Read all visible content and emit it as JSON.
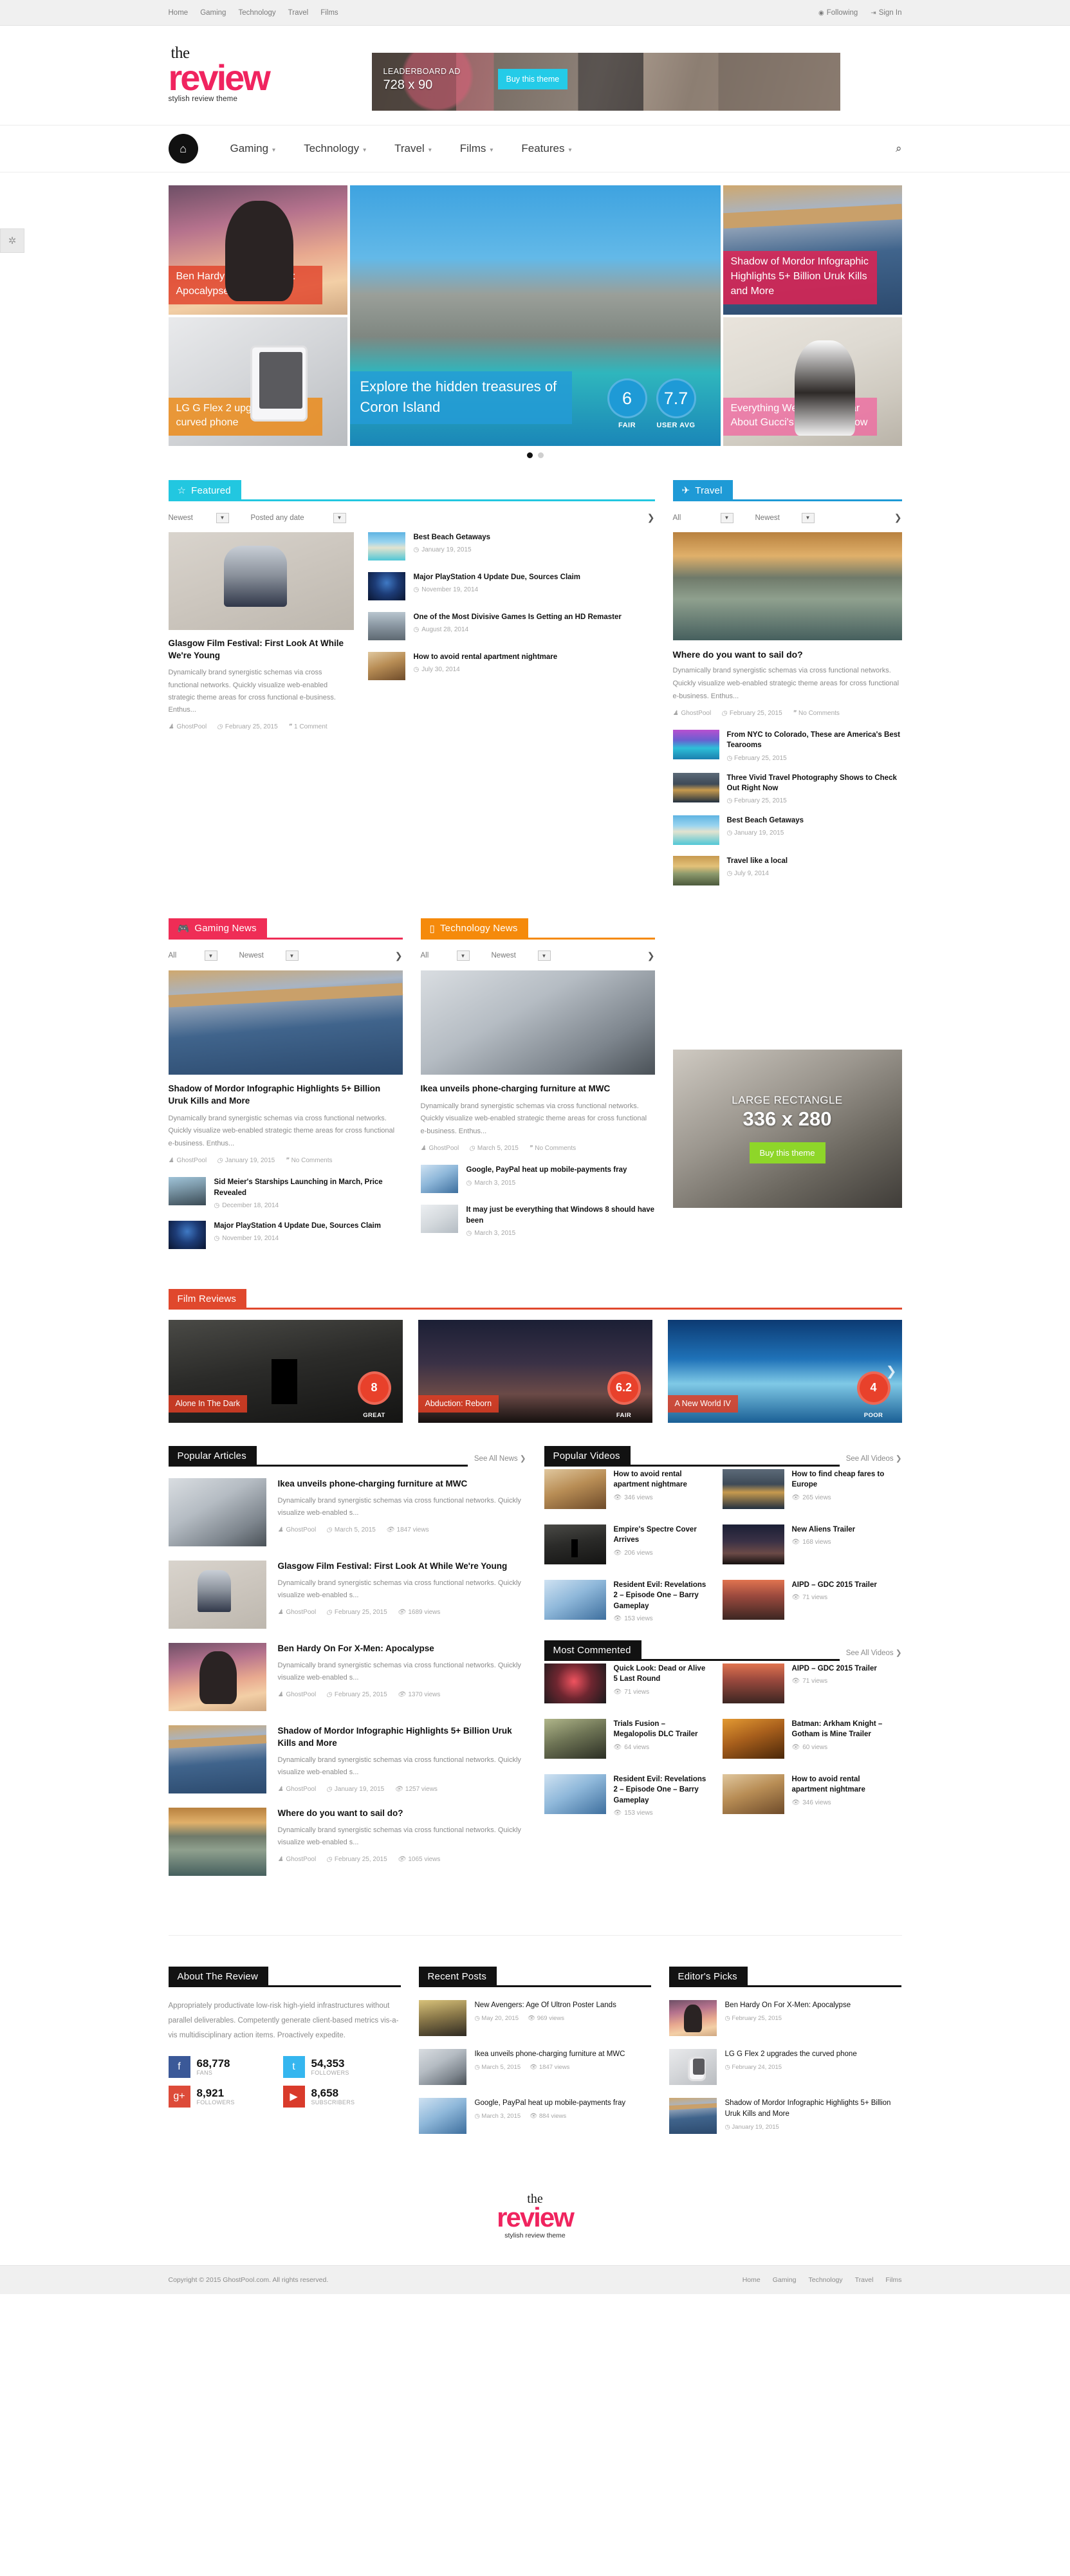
{
  "topbar": {
    "nav": [
      "Home",
      "Gaming",
      "Technology",
      "Travel",
      "Films"
    ],
    "following": "Following",
    "signin": "Sign In"
  },
  "logo": {
    "the": "the",
    "review": "review",
    "tagline": "stylish review theme"
  },
  "leaderboard_ad": {
    "line1": "LEADERBOARD AD",
    "line2": "728 x 90",
    "button": "Buy this theme"
  },
  "mainnav": {
    "items": [
      "Gaming",
      "Technology",
      "Travel",
      "Films",
      "Features"
    ]
  },
  "hero": {
    "left": [
      {
        "title": "Ben Hardy On For X-Men: Apocalypse",
        "cap_class": "red",
        "img": "im-hood"
      },
      {
        "title": "LG G Flex 2 upgrades the curved phone",
        "cap_class": "orange",
        "img": "im-phone"
      }
    ],
    "main": {
      "title": "Explore the hidden treasures of Coron Island",
      "cap_class": "blue",
      "img": "im-island",
      "scores": [
        {
          "value": "6",
          "label": "FAIR"
        },
        {
          "value": "7.7",
          "label": "USER AVG"
        }
      ]
    },
    "right": [
      {
        "title": "Shadow of Mordor Infographic Highlights 5+ Billion Uruk Kills and More",
        "cap_class": "crimson",
        "img": "im-bridge"
      },
      {
        "title": "Everything We Know So Far About Gucci's Fall 2015 Show",
        "cap_class": "pink",
        "img": "im-couple"
      }
    ]
  },
  "featured": {
    "tab": "Featured",
    "icon": "star-icon",
    "filters": [
      {
        "label": "Newest"
      },
      {
        "label": "Posted any date"
      }
    ],
    "main": {
      "img": "im-dj",
      "title": "Glasgow Film Festival: First Look At While We're Young",
      "excerpt": "Dynamically brand synergistic schemas via cross functional networks. Quickly visualize web-enabled strategic theme areas for cross functional e-business. Enthus...",
      "author": "GhostPool",
      "date": "February 25, 2015",
      "comments": "1 Comment"
    },
    "list": [
      {
        "title": "Best Beach Getaways",
        "date": "January 19, 2015",
        "img": "im-beach"
      },
      {
        "title": "Major PlayStation 4 Update Due, Sources Claim",
        "date": "November 19, 2014",
        "img": "im-ps"
      },
      {
        "title": "One of the Most Divisive Games Is Getting an HD Remaster",
        "date": "August 28, 2014",
        "img": "im-zombie"
      },
      {
        "title": "How to avoid rental apartment nightmare",
        "date": "July 30, 2014",
        "img": "im-room"
      }
    ]
  },
  "travel": {
    "tab": "Travel",
    "icon": "plane-icon",
    "filters": [
      {
        "label": "All"
      },
      {
        "label": "Newest"
      }
    ],
    "main": {
      "img": "im-pier",
      "title": "Where do you want to sail do?",
      "excerpt": "Dynamically brand synergistic schemas via cross functional networks. Quickly visualize web-enabled strategic theme areas for cross functional e-business. Enthus...",
      "author": "GhostPool",
      "date": "February 25, 2015",
      "comments": "No Comments"
    },
    "list": [
      {
        "title": "From NYC to Colorado, These are America's Best Tearooms",
        "date": "February 25, 2015",
        "img": "im-nyc"
      },
      {
        "title": "Three Vivid Travel Photography Shows to Check Out Right Now",
        "date": "February 25, 2015",
        "img": "im-lake"
      },
      {
        "title": "Best Beach Getaways",
        "date": "January 19, 2015",
        "img": "im-beach"
      },
      {
        "title": "Travel like a local",
        "date": "July 9, 2014",
        "img": "im-sunset"
      }
    ]
  },
  "gaming": {
    "tab": "Gaming News",
    "icon": "gamepad-icon",
    "filters": [
      {
        "label": "All"
      },
      {
        "label": "Newest"
      }
    ],
    "main": {
      "img": "im-bridge",
      "title": "Shadow of Mordor Infographic Highlights 5+ Billion Uruk Kills and More",
      "excerpt": "Dynamically brand synergistic schemas via cross functional networks. Quickly visualize web-enabled strategic theme areas for cross functional e-business. Enthus...",
      "author": "GhostPool",
      "date": "January 19, 2015",
      "comments": "No Comments"
    },
    "list": [
      {
        "title": "Sid Meier's Starships Launching in March, Price Revealed",
        "date": "December 18, 2014",
        "img": "im-starship"
      },
      {
        "title": "Major PlayStation 4 Update Due, Sources Claim",
        "date": "November 19, 2014",
        "img": "im-ps"
      }
    ]
  },
  "technology": {
    "tab": "Technology News",
    "icon": "mobile-icon",
    "filters": [
      {
        "label": "All"
      },
      {
        "label": "Newest"
      }
    ],
    "main": {
      "img": "im-tech",
      "title": "Ikea unveils phone-charging furniture at MWC",
      "excerpt": "Dynamically brand synergistic schemas via cross functional networks. Quickly visualize web-enabled strategic theme areas for cross functional e-business. Enthus...",
      "author": "GhostPool",
      "date": "March 5, 2015",
      "comments": "No Comments"
    },
    "list": [
      {
        "title": "Google, PayPal heat up mobile-payments fray",
        "date": "March 3, 2015",
        "img": "im-kbd"
      },
      {
        "title": "It may just be everything that Windows 8 should have been",
        "date": "March 3, 2015",
        "img": "im-win"
      }
    ]
  },
  "rect_ad": {
    "line1": "LARGE RECTANGLE",
    "line2": "336 x 280",
    "button": "Buy this theme"
  },
  "film_reviews": {
    "tab": "Film Reviews",
    "items": [
      {
        "name": "Alone In The Dark",
        "score": "8",
        "label": "GREAT",
        "img": "im-dark"
      },
      {
        "name": "Abduction: Reborn",
        "score": "6.2",
        "label": "FAIR",
        "img": "im-ufo"
      },
      {
        "name": "A New World IV",
        "score": "4",
        "label": "POOR",
        "img": "im-world"
      }
    ]
  },
  "popular_articles": {
    "tab": "Popular Articles",
    "seeall": "See All News",
    "items": [
      {
        "title": "Ikea unveils phone-charging furniture at MWC",
        "excerpt": "Dynamically brand synergistic schemas via cross functional networks. Quickly visualize web-enabled s...",
        "author": "GhostPool",
        "date": "March 5, 2015",
        "views": "1847 views",
        "img": "im-tech"
      },
      {
        "title": "Glasgow Film Festival: First Look At While We're Young",
        "excerpt": "Dynamically brand synergistic schemas via cross functional networks. Quickly visualize web-enabled s...",
        "author": "GhostPool",
        "date": "February 25, 2015",
        "views": "1689 views",
        "img": "im-dj"
      },
      {
        "title": "Ben Hardy On For X-Men: Apocalypse",
        "excerpt": "Dynamically brand synergistic schemas via cross functional networks. Quickly visualize web-enabled s...",
        "author": "GhostPool",
        "date": "February 25, 2015",
        "views": "1370 views",
        "img": "im-hood"
      },
      {
        "title": "Shadow of Mordor Infographic Highlights 5+ Billion Uruk Kills and More",
        "excerpt": "Dynamically brand synergistic schemas via cross functional networks. Quickly visualize web-enabled s...",
        "author": "GhostPool",
        "date": "January 19, 2015",
        "views": "1257 views",
        "img": "im-bridge"
      },
      {
        "title": "Where do you want to sail do?",
        "excerpt": "Dynamically brand synergistic schemas via cross functional networks. Quickly visualize web-enabled s...",
        "author": "GhostPool",
        "date": "February 25, 2015",
        "views": "1065 views",
        "img": "im-pier"
      }
    ]
  },
  "popular_videos": {
    "tab": "Popular Videos",
    "seeall": "See All Videos",
    "items": [
      {
        "title": "How to avoid rental apartment nightmare",
        "views": "346 views",
        "img": "im-room"
      },
      {
        "title": "How to find cheap fares to Europe",
        "views": "265 views",
        "img": "im-lake"
      },
      {
        "title": "Empire's Spectre Cover Arrives",
        "views": "206 views",
        "img": "im-dark"
      },
      {
        "title": "New Aliens Trailer",
        "views": "168 views",
        "img": "im-ufo"
      },
      {
        "title": "Resident Evil: Revelations 2 – Episode One – Barry Gameplay",
        "views": "153 views",
        "img": "im-kbd"
      },
      {
        "title": "AIPD – GDC 2015 Trailer",
        "views": "71 views",
        "img": "im-aipd"
      }
    ]
  },
  "most_commented": {
    "tab": "Most Commented",
    "seeall": "See All Videos",
    "items": [
      {
        "title": "Quick Look: Dead or Alive 5 Last Round",
        "views": "71 views",
        "img": "im-hand"
      },
      {
        "title": "AIPD – GDC 2015 Trailer",
        "views": "71 views",
        "img": "im-aipd"
      },
      {
        "title": "Trials Fusion – Megalopolis DLC Trailer",
        "views": "64 views",
        "img": "im-trials"
      },
      {
        "title": "Batman: Arkham Knight – Gotham is Mine Trailer",
        "views": "60 views",
        "img": "im-batman"
      },
      {
        "title": "Resident Evil: Revelations 2 – Episode One – Barry Gameplay",
        "views": "153 views",
        "img": "im-kbd"
      },
      {
        "title": "How to avoid rental apartment nightmare",
        "views": "346 views",
        "img": "im-room"
      }
    ]
  },
  "about": {
    "tab": "About The Review",
    "text": "Appropriately productivate low-risk high-yield infrastructures without parallel deliverables. Competently generate client-based metrics vis-a-vis multidisciplinary action items. Proactively expedite.",
    "socials": [
      {
        "network": "facebook-icon",
        "glyph": "f",
        "count": "68,778",
        "caption": "FANS",
        "cls": "fb"
      },
      {
        "network": "twitter-icon",
        "glyph": "t",
        "count": "54,353",
        "caption": "FOLLOWERS",
        "cls": "tw"
      },
      {
        "network": "googleplus-icon",
        "glyph": "g+",
        "count": "8,921",
        "caption": "FOLLOWERS",
        "cls": "gp"
      },
      {
        "network": "youtube-icon",
        "glyph": "▶",
        "count": "8,658",
        "caption": "SUBSCRIBERS",
        "cls": "yt"
      }
    ]
  },
  "recent_posts": {
    "tab": "Recent Posts",
    "items": [
      {
        "title": "New Avengers: Age Of Ultron Poster Lands",
        "date": "May 20, 2015",
        "views": "969 views",
        "img": "im-avengers"
      },
      {
        "title": "Ikea unveils phone-charging furniture at MWC",
        "date": "March 5, 2015",
        "views": "1847 views",
        "img": "im-tech"
      },
      {
        "title": "Google, PayPal heat up mobile-payments fray",
        "date": "March 3, 2015",
        "views": "884 views",
        "img": "im-kbd"
      }
    ]
  },
  "editors_picks": {
    "tab": "Editor's Picks",
    "items": [
      {
        "title": "Ben Hardy On For X-Men: Apocalypse",
        "date": "February 25, 2015",
        "img": "im-hood"
      },
      {
        "title": "LG G Flex 2 upgrades the curved phone",
        "date": "February 24, 2015",
        "img": "im-phone"
      },
      {
        "title": "Shadow of Mordor Infographic Highlights 5+ Billion Uruk Kills and More",
        "date": "January 19, 2015",
        "img": "im-bridge"
      }
    ]
  },
  "footer": {
    "copyright": "Copyright © 2015 GhostPool.com. All rights reserved.",
    "nav": [
      "Home",
      "Gaming",
      "Technology",
      "Travel",
      "Films"
    ]
  }
}
